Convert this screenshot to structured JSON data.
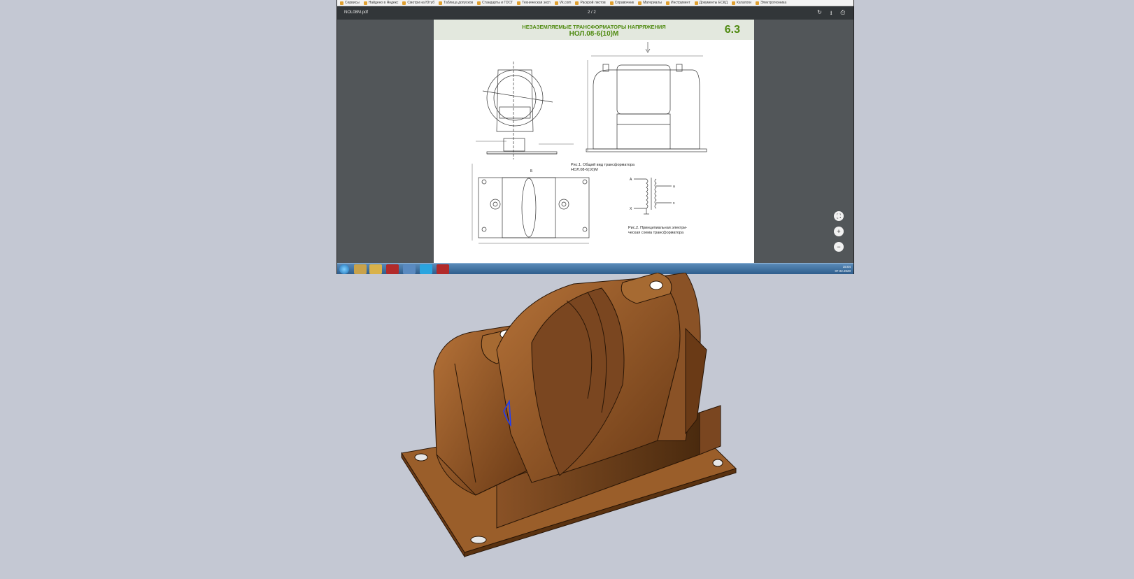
{
  "browser": {
    "bookmarks": [
      "Сервисы",
      "Найдено в Яндекс",
      "Смотри на Ютуб",
      "Таблица допусков",
      "Стандарты и ГОСТ",
      "Техническая эксп",
      "Vk.com",
      "Раскрой листов",
      "Справочник",
      "Материалы",
      "Инструмент",
      "Документы ЕСКД",
      "Каталоги",
      "Электротехника"
    ]
  },
  "pdf_viewer": {
    "file_name": "NOL08M.pdf",
    "page_indicator": "2 / 2",
    "page": {
      "heading_line1": "НЕЗАЗЕМЛЯЕМЫЕ ТРАНСФОРМАТОРЫ НАПРЯЖЕНИЯ",
      "heading_line2": "НОЛ.08-6(10)М",
      "section_number": "6.3",
      "fig1_caption_line1": "Рис.1. Общий вид трансформатора",
      "fig1_caption_line2": "НОЛ.08-6(10)М",
      "fig2_caption_line1": "Рис.2. Принципиальная электри-",
      "fig2_caption_line2": "ческая схема трансформатора",
      "view_label": "Б",
      "scheme_labels": [
        "A",
        "a",
        "X",
        "x"
      ]
    },
    "zoom_buttons": [
      "fit",
      "+",
      "−"
    ]
  },
  "taskbar": {
    "clock_time": "15:04",
    "clock_date": "07.02.2020"
  },
  "colors": {
    "desktop": "#c4c8d3",
    "model_body": "#8a5226",
    "heading_green": "#4f8a10"
  }
}
